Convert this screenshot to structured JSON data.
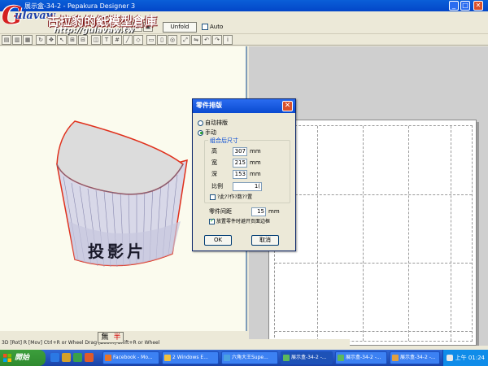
{
  "window": {
    "title": "展示盒-34-2 - Pepakura Designer 3",
    "controls": [
      "_",
      "□",
      "✕"
    ]
  },
  "logo": {
    "brand": "古拉豹的紙模型倉庫",
    "url": "http://gulavaw.tw"
  },
  "toolbar": {
    "unfold_label": "Unfold",
    "auto_label": "Auto"
  },
  "model": {
    "band_text": "投影片"
  },
  "dialog": {
    "title": "零件排版",
    "radio_auto": "自动排版",
    "radio_manual": "手动",
    "group_title": "组合后尺寸",
    "height_label": "高",
    "height_value": "307",
    "width_label": "宽",
    "width_value": "215",
    "depth_label": "深",
    "depth_value": "153",
    "unit_mm": "mm",
    "scale_label": "比例",
    "scale_value": "1(",
    "fix_ratio_label": "?此??作?数??置",
    "spacing_label": "零件间距",
    "spacing_value": "15",
    "fit_page_label": "放置零件时避开页面边框",
    "fit_page_checked": true,
    "ok_label": "OK",
    "cancel_label": "取消"
  },
  "statusbar": {
    "text": "3D [Rot] R [Mov] Ctrl+R or Wheel Drag [Zoom] Shift+R or Wheel"
  },
  "ime": {
    "left": "無",
    "right": "半"
  },
  "taskbar": {
    "start_label": "開始",
    "tasks": [
      {
        "label": "Facebook - Mo...",
        "color": "#e8742a"
      },
      {
        "label": "2 Windows E...",
        "color": "#f0c040"
      },
      {
        "label": "六角大王Supe...",
        "color": "#4aa0e0"
      },
      {
        "label": "展示盒-34-2 -...",
        "color": "#5cb85c"
      },
      {
        "label": "展示盒-34-2 -...",
        "color": "#5cb85c"
      },
      {
        "label": "展示盒-34-2 -...",
        "color": "#e0a040"
      }
    ],
    "clock": "上午 01:24"
  }
}
